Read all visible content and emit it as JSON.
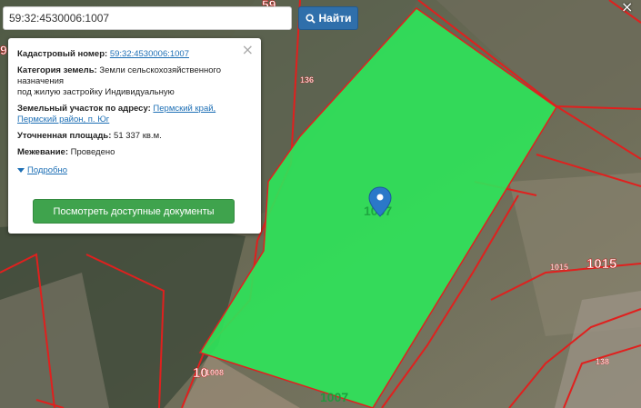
{
  "search": {
    "value": "59:32:4530006:1007",
    "button_label": "Найти",
    "corner_close": "×"
  },
  "info": {
    "close": "×",
    "cadastral_label": "Кадастровый номер:",
    "cadastral_value": "59:32:4530006:1007",
    "category_label": "Категория земель:",
    "category_value_1": "Земли сельскохозяйственного",
    "category_value_2": "назначения",
    "category_value_3": "под жилую застройку Индивидуальную",
    "address_label": "Земельный участок по адресу:",
    "address_value_1": "Пермский край,",
    "address_value_2": "Пермский район, п. Юг",
    "area_label": "Уточненная площадь:",
    "area_value": "51 337 кв.м.",
    "survey_label": "Межевание:",
    "survey_value": "Проведено",
    "more_label": "Подробно",
    "docs_button": "Посмотреть доступные документы"
  },
  "map": {
    "labels": {
      "p136a": "136",
      "p1015_small": "1015",
      "p1015_big": "1015",
      "p1007_center": "1007",
      "p1007_bottom": "1007",
      "p1008": "1008",
      "p10_partial": "10",
      "p138": "138",
      "p5_partial": "59",
      "p9_partial": "9"
    },
    "colors": {
      "selected_fill": "#2ee65a",
      "boundary": "#e0201e",
      "marker": "#2b78c9"
    }
  }
}
